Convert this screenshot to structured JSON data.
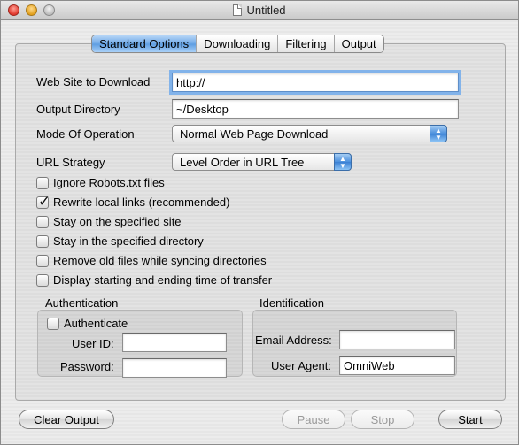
{
  "window": {
    "title": "Untitled"
  },
  "tabs": [
    "Standard Options",
    "Downloading",
    "Filtering",
    "Output"
  ],
  "form": {
    "website_label": "Web Site to Download",
    "website_value": "http://",
    "output_label": "Output Directory",
    "output_value": "~/Desktop",
    "mode_label": "Mode Of Operation",
    "mode_value": "Normal Web Page Download",
    "url_label": "URL Strategy",
    "url_value": "Level Order in URL Tree"
  },
  "options": [
    {
      "label": "Ignore Robots.txt files",
      "checked": false
    },
    {
      "label": "Rewrite local links (recommended)",
      "checked": true
    },
    {
      "label": "Stay on the specified site",
      "checked": false
    },
    {
      "label": "Stay in the specified directory",
      "checked": false
    },
    {
      "label": "Remove old files while syncing directories",
      "checked": false
    },
    {
      "label": "Display starting and ending time of transfer",
      "checked": false
    }
  ],
  "authentication": {
    "title": "Authentication",
    "checkbox_label": "Authenticate",
    "checked": false,
    "user_id_label": "User ID:",
    "user_id_value": "",
    "password_label": "Password:",
    "password_value": ""
  },
  "identification": {
    "title": "Identification",
    "email_label": "Email Address:",
    "email_value": "",
    "agent_label": "User Agent:",
    "agent_value": "OmniWeb"
  },
  "buttons": {
    "clear_output": "Clear Output",
    "pause": "Pause",
    "stop": "Stop",
    "start": "Start"
  }
}
